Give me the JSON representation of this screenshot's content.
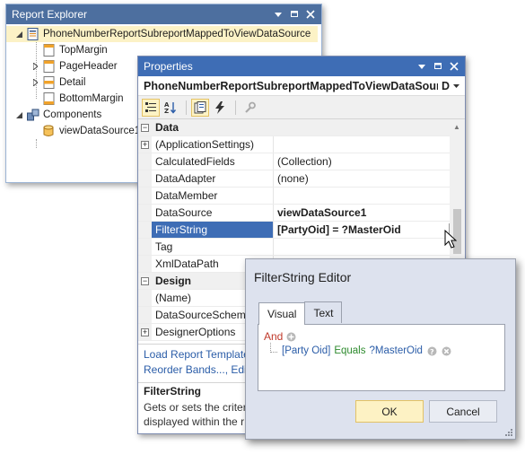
{
  "report_explorer": {
    "title": "Report Explorer",
    "tree": [
      {
        "label": "PhoneNumberReportSubreportMappedToViewDataSource",
        "level": 0,
        "selected": true,
        "icon": "report-icon"
      },
      {
        "label": "TopMargin",
        "level": 1,
        "icon": "band-icon"
      },
      {
        "label": "PageHeader",
        "level": 1,
        "icon": "band-icon"
      },
      {
        "label": "Detail",
        "level": 1,
        "icon": "band-icon"
      },
      {
        "label": "BottomMargin",
        "level": 1,
        "icon": "band-icon"
      },
      {
        "label": "Components",
        "level": 0,
        "icon": "components-icon"
      },
      {
        "label": "viewDataSource1",
        "level": 1,
        "icon": "datasource-icon"
      }
    ]
  },
  "properties": {
    "title": "Properties",
    "object_name": "PhoneNumberReportSubreportMappedToViewDataSource",
    "object_suffix": "D",
    "categories": {
      "data": "Data",
      "design": "Design"
    },
    "rows": [
      {
        "name": "(ApplicationSettings)",
        "value": ""
      },
      {
        "name": "CalculatedFields",
        "value": "(Collection)"
      },
      {
        "name": "DataAdapter",
        "value": "(none)"
      },
      {
        "name": "DataMember",
        "value": ""
      },
      {
        "name": "DataSource",
        "value": "viewDataSource1"
      },
      {
        "name": "FilterString",
        "value": "[PartyOid] = ?MasterOid"
      },
      {
        "name": "Tag",
        "value": ""
      },
      {
        "name": "XmlDataPath",
        "value": ""
      }
    ],
    "design_rows": [
      {
        "name": "(Name)",
        "value": ""
      },
      {
        "name": "DataSourceSchema",
        "value": ""
      },
      {
        "name": "DesignerOptions",
        "value": ""
      }
    ],
    "ellipsis": "...",
    "links": [
      "Load Report Template",
      "Reorder Bands..., Edit"
    ],
    "description_title": "FilterString",
    "description_lines": [
      "Gets or sets the criteri",
      "displayed within the r"
    ]
  },
  "filter_editor": {
    "title": "FilterString Editor",
    "tabs": [
      "Visual",
      "Text"
    ],
    "group_operator": "And",
    "condition": {
      "field": "[Party Oid]",
      "operator": "Equals",
      "value": "?MasterOid"
    },
    "ok_label": "OK",
    "cancel_label": "Cancel"
  },
  "colors": {
    "explorer_title": "#4d6f9f",
    "properties_title": "#3e6db5",
    "selection_highlight": "#fcf2c6",
    "operator_red": "#c0392b",
    "field_blue": "#2b5da8",
    "condition_green": "#2e8b2e"
  }
}
